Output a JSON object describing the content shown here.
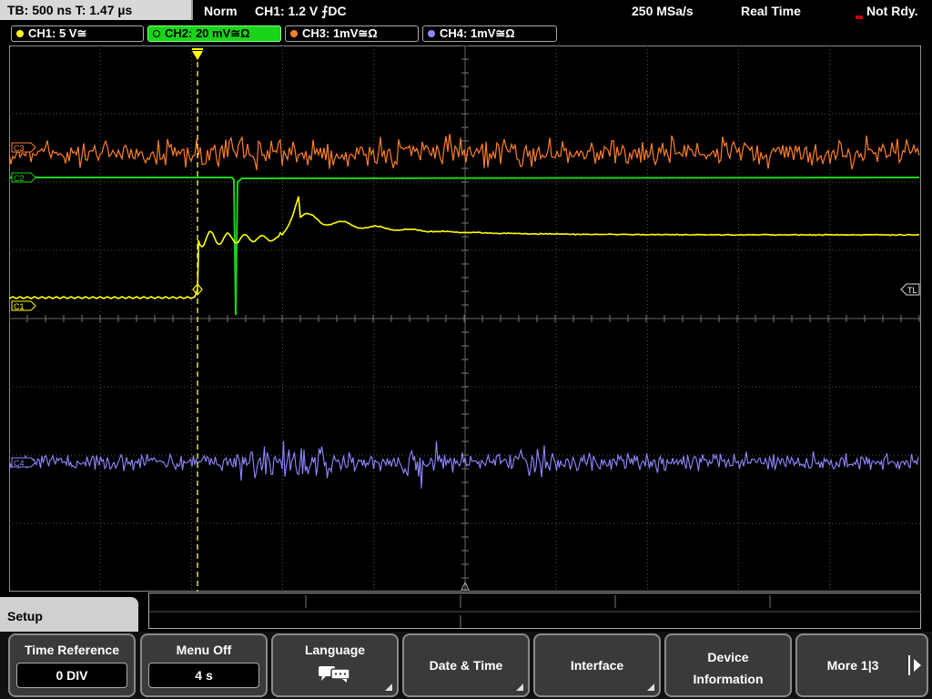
{
  "status": {
    "timebase": "TB: 500 ns   T: 1.47 µs",
    "trigger_mode": "Norm",
    "trigger_info": "CH1: 1.2 V ⨍DC",
    "sample_rate": "250 MSa/s",
    "acq_mode": "Real Time",
    "state": "Not Rdy."
  },
  "channels": [
    {
      "label": "CH1: 5 V≅",
      "color": "#ffff00"
    },
    {
      "label": "CH2: 20 mV≅Ω",
      "color": "#19d419"
    },
    {
      "label": "CH3: 1mV≅Ω",
      "color": "#ff7f27"
    },
    {
      "label": "CH4: 1mV≅Ω",
      "color": "#8f88ff"
    }
  ],
  "markers": {
    "c3": "C3",
    "c2": "C2",
    "c1": "C1",
    "c4": "C4",
    "tl": "TL"
  },
  "menu": {
    "title": "Setup",
    "softkeys": [
      {
        "label": "Time Reference",
        "value": "0 DIV"
      },
      {
        "label": "Menu Off",
        "value": "4 s"
      },
      {
        "label": "Language",
        "icon": "speech-bubbles-icon"
      },
      {
        "label": "Date & Time"
      },
      {
        "label": "Interface"
      },
      {
        "label1": "Device",
        "label2": "Information"
      },
      {
        "label": "More 1|3"
      }
    ]
  }
}
